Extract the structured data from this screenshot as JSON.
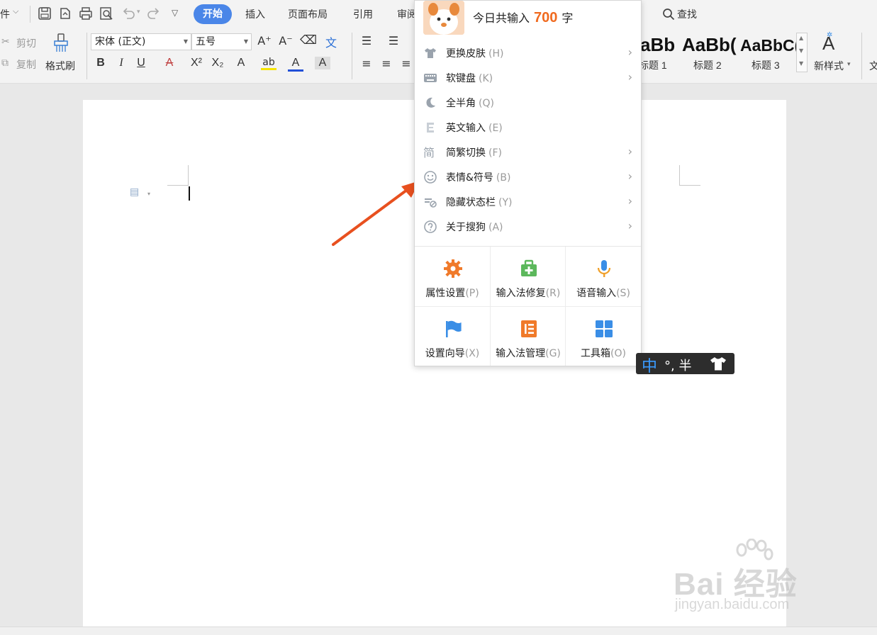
{
  "menubar": {
    "file_fragment": "件",
    "tabs": [
      "开始",
      "插入",
      "页面布局",
      "引用",
      "审阅"
    ],
    "search_label": "查找"
  },
  "ribbon": {
    "cut": "剪切",
    "copy": "复制",
    "format_painter": "格式刷",
    "font_name": "宋体 (正文)",
    "font_size": "五号",
    "styles": [
      {
        "sample": "aBb",
        "label": "标题 1"
      },
      {
        "sample": "AaBb(",
        "label": "标题 2"
      },
      {
        "sample": "AaBbC(",
        "label": "标题 3"
      }
    ],
    "new_style": "新样式",
    "trailing_fragment": "文"
  },
  "ime_menu": {
    "header_prefix": "今日共输入",
    "header_count": "700",
    "header_suffix": "字",
    "items": [
      {
        "label": "更换皮肤",
        "key": "(H)",
        "icon": "tshirt-icon",
        "submenu": true
      },
      {
        "label": "软键盘",
        "key": "(K)",
        "icon": "keyboard-icon",
        "submenu": true
      },
      {
        "label": "全半角",
        "key": "(Q)",
        "icon": "moon-icon",
        "submenu": false
      },
      {
        "label": "英文输入",
        "key": "(E)",
        "icon": "letter-e-icon",
        "submenu": false
      },
      {
        "label": "简繁切换",
        "key": "(F)",
        "icon": "jian-char-icon",
        "submenu": true
      },
      {
        "label": "表情&符号",
        "key": "(B)",
        "icon": "smiley-icon",
        "submenu": true
      },
      {
        "label": "隐藏状态栏",
        "key": "(Y)",
        "icon": "hide-statusbar-icon",
        "submenu": true
      },
      {
        "label": "关于搜狗",
        "key": "(A)",
        "icon": "help-icon",
        "submenu": true
      }
    ],
    "grid": [
      {
        "label": "属性设置",
        "key": "(P)",
        "icon": "gear-icon",
        "color": "#f07a2a"
      },
      {
        "label": "输入法修复",
        "key": "(R)",
        "icon": "repair-kit-icon",
        "color": "#5cb85c"
      },
      {
        "label": "语音输入",
        "key": "(S)",
        "icon": "microphone-icon",
        "color": "#3a8ee6"
      },
      {
        "label": "设置向导",
        "key": "(X)",
        "icon": "flag-icon",
        "color": "#3a8ee6"
      },
      {
        "label": "输入法管理",
        "key": "(G)",
        "icon": "manage-icon",
        "color": "#f07a2a"
      },
      {
        "label": "工具箱",
        "key": "(O)",
        "icon": "toolbox-icon",
        "color": "#3a8ee6"
      }
    ]
  },
  "ime_status": {
    "mode": "中",
    "rest": "°, 半"
  },
  "watermark": {
    "main": "Bai 经验",
    "sub": "jingyan.baidu.com"
  },
  "colors": {
    "accent": "#4a86e8",
    "count": "#f06a1f",
    "arrow": "#e8501f"
  }
}
